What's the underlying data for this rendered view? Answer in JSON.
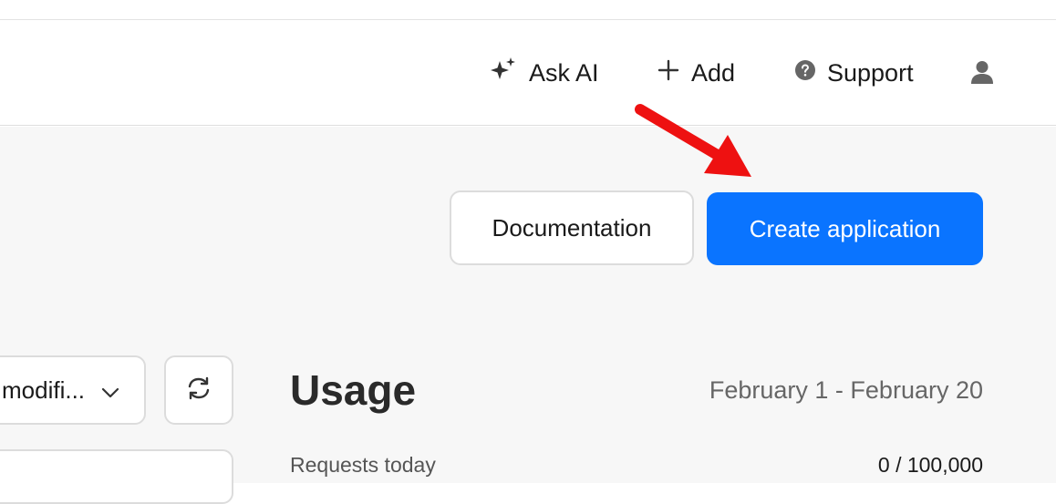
{
  "header": {
    "nav": {
      "ask_ai": "Ask AI",
      "add": "Add",
      "support": "Support"
    }
  },
  "actions": {
    "documentation": "Documentation",
    "create_application": "Create application"
  },
  "filters": {
    "sort_select": "modifi..."
  },
  "usage": {
    "title": "Usage",
    "date_range": "February 1 - February 20",
    "requests_today_label": "Requests today",
    "requests_today_value": "0 / 100,000"
  },
  "colors": {
    "primary": "#0a74ff",
    "annotation_arrow": "#ee1111"
  },
  "icons": [
    "sparkle-icon",
    "plus-icon",
    "help-circle-icon",
    "user-icon",
    "chevron-down-icon",
    "refresh-icon"
  ]
}
